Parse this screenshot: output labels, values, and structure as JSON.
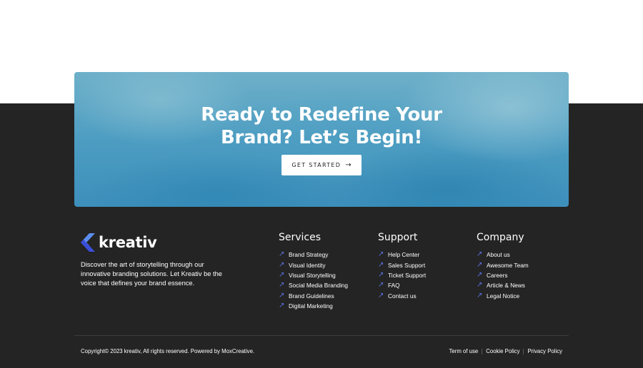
{
  "cta": {
    "title_line1": "Ready to Redefine Your",
    "title_line2": "Brand? Let’s Begin!",
    "button_label": "GET STARTED",
    "button_icon": "arrow-right-icon"
  },
  "brand": {
    "name": "kreativ",
    "logo_colors": [
      "#5b8def",
      "#3a4fd9"
    ],
    "description": "Discover the art of storytelling through our innovative branding solutions. Let Kreativ be the voice that defines your brand essence."
  },
  "columns": {
    "services": {
      "title": "Services",
      "items": [
        "Brand Strategy",
        "Visual Identity",
        "Visual Storytelling",
        "Social Media Branding",
        "Brand Guidelines",
        "Digital Marketing"
      ]
    },
    "support": {
      "title": "Support",
      "items": [
        "Help Center",
        "Sales Support",
        "Ticket Support",
        "FAQ",
        "Contact us"
      ]
    },
    "company": {
      "title": "Company",
      "items": [
        "About us",
        "Awesome Team",
        "Careers",
        "Article & News",
        "Legal Notice"
      ]
    }
  },
  "link_icon": "arrow-up-right-icon",
  "accent_color": "#5b73e8",
  "footer": {
    "copyright": "Copyright© 2023 kreativ, All rights reserved. Powered by MoxCreative.",
    "legal_links": [
      "Term of use",
      "Cookie Policy",
      "Privacy Policy"
    ]
  }
}
